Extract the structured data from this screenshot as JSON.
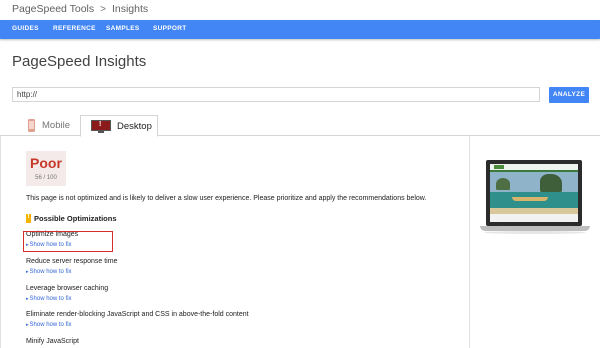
{
  "breadcrumb": {
    "root": "PageSpeed Tools",
    "separator": ">",
    "current": "Insights"
  },
  "nav": {
    "items": [
      "GUIDES",
      "REFERENCE",
      "SAMPLES",
      "SUPPORT"
    ]
  },
  "page_title": "PageSpeed Insights",
  "url_input": {
    "value": "http://"
  },
  "analyze_button": "ANALYZE",
  "tabs": [
    {
      "label": "Mobile",
      "icon": "phone-icon",
      "selected": false
    },
    {
      "label": "Desktop",
      "icon": "monitor-icon",
      "selected": true
    }
  ],
  "score": {
    "label": "Poor",
    "value": "56 / 100",
    "color": "#c53929"
  },
  "summary": "This page is not optimized and is likely to deliver a slow user experience. Please prioritize and apply the recommendations below.",
  "section": {
    "title": "Possible Optimizations",
    "icon": "warning-icon",
    "color": "#f4b400"
  },
  "rules": [
    {
      "title": "Optimize images",
      "fix": "Show how to fix",
      "highlighted": true
    },
    {
      "title": "Reduce server response time",
      "fix": "Show how to fix"
    },
    {
      "title": "Leverage browser caching",
      "fix": "Show how to fix"
    },
    {
      "title": "Eliminate render-blocking JavaScript and CSS in above-the-fold content",
      "fix": "Show how to fix"
    },
    {
      "title": "Minify JavaScript"
    }
  ],
  "colors": {
    "accent": "#4285f4",
    "link": "#3367d6",
    "highlight_border": "#d32f2f"
  }
}
